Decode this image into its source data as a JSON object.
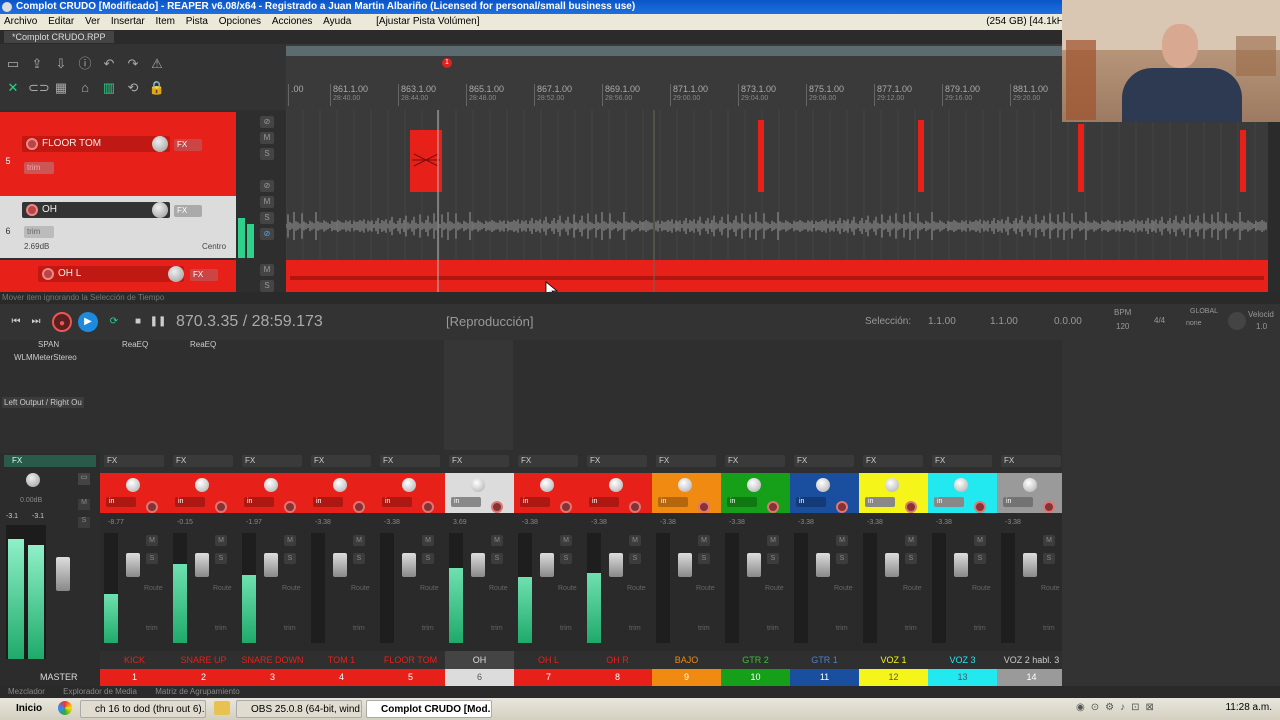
{
  "window": {
    "title": "Complot CRUDO [Modificado] - REAPER v6.08/x64 - Registrado a Juan Martin Albariño (Licensed for personal/small business use)"
  },
  "menu": {
    "items": [
      "Archivo",
      "Editar",
      "Ver",
      "Insertar",
      "Item",
      "Pista",
      "Opciones",
      "Acciones",
      "Ayuda",
      "[Ajustar Pista Volúmen]"
    ],
    "disk_info": "(254 GB) [44.1kH"
  },
  "project_tab": "*Complot CRUDO.RPP",
  "ruler": {
    "marker": "1",
    "ticks": [
      {
        "bar": ".00",
        "time": ""
      },
      {
        "bar": "861.1.00",
        "time": "28:40.00"
      },
      {
        "bar": "863.1.00",
        "time": "28:44.00"
      },
      {
        "bar": "865.1.00",
        "time": "28:48.00"
      },
      {
        "bar": "867.1.00",
        "time": "28:52.00"
      },
      {
        "bar": "869.1.00",
        "time": "28:56.00"
      },
      {
        "bar": "871.1.00",
        "time": "29:00.00"
      },
      {
        "bar": "873.1.00",
        "time": "29:04.00"
      },
      {
        "bar": "875.1.00",
        "time": "29:08.00"
      },
      {
        "bar": "877.1.00",
        "time": "29:12.00"
      },
      {
        "bar": "879.1.00",
        "time": "29:16.00"
      },
      {
        "bar": "881.1.00",
        "time": "29:20.00"
      }
    ]
  },
  "tracks": [
    {
      "num": "5",
      "name": "FLOOR TOM",
      "fx": "FX",
      "trim": "trim",
      "color": "#e8201a"
    },
    {
      "num": "6",
      "name": "OH",
      "fx": "FX",
      "trim": "trim",
      "vol": "2.69dB",
      "pan": "Centro",
      "color": "#dcdcdc"
    },
    {
      "num": "",
      "name": "OH L",
      "fx": "FX",
      "color": "#e8201a"
    }
  ],
  "status": {
    "hint": "Mover item ignorando la Selección de Tiempo"
  },
  "transport": {
    "time": "870.3.35 / 28:59.173",
    "state": "[Reproducción]",
    "selection_label": "Selección:",
    "sel_start": "1.1.00",
    "sel_end": "1.1.00",
    "sel_len": "0.0.00",
    "bpm_label": "BPM",
    "bpm": "120",
    "timesig": "4/4",
    "global_label": "GLOBAL",
    "global_value": "none",
    "rate_label": "Velocid",
    "rate_value": "1.0"
  },
  "mixer": {
    "master_fx": [
      "SPAN",
      "WLMMeterStereo"
    ],
    "reaeq1": "ReaEQ",
    "reaeq2": "ReaEQ",
    "master_io": "Left Output / Right Ou",
    "master_label": "MASTER",
    "master_vol": "0.00dB",
    "master_peak_l": "-3.1",
    "master_peak_r": "-3.1",
    "strips": [
      {
        "name": "KICK",
        "num": "1",
        "color": "#e8201a",
        "namecolor": "#e8201a",
        "vol": "-8.77",
        "level": 0.45
      },
      {
        "name": "SNARE UP",
        "num": "2",
        "color": "#e8201a",
        "namecolor": "#e8201a",
        "vol": "-0.15",
        "level": 0.72
      },
      {
        "name": "SNARE DOWN",
        "num": "3",
        "color": "#e8201a",
        "namecolor": "#e8201a",
        "vol": "-1.97",
        "level": 0.62
      },
      {
        "name": "TOM 1",
        "num": "4",
        "color": "#e8201a",
        "namecolor": "#e8201a",
        "vol": "-3.38",
        "level": 0.0
      },
      {
        "name": "FLOOR TOM",
        "num": "5",
        "color": "#e8201a",
        "namecolor": "#e8201a",
        "vol": "-3.38",
        "level": 0.0
      },
      {
        "name": "OH",
        "num": "6",
        "color": "#dcdcdc",
        "namecolor": "#dddddd",
        "vol": "3.69",
        "level": 0.68
      },
      {
        "name": "OH L",
        "num": "7",
        "color": "#e8201a",
        "namecolor": "#e8201a",
        "vol": "-3.38",
        "level": 0.6
      },
      {
        "name": "OH R",
        "num": "8",
        "color": "#e8201a",
        "namecolor": "#e8201a",
        "vol": "-3.38",
        "level": 0.64
      },
      {
        "name": "BAJO",
        "num": "9",
        "color": "#f08a10",
        "namecolor": "#f08a10",
        "vol": "-3.38",
        "level": 0.0
      },
      {
        "name": "GTR 2",
        "num": "10",
        "color": "#16a01a",
        "namecolor": "#35c035",
        "vol": "-3.38",
        "level": 0.0
      },
      {
        "name": "GTR 1",
        "num": "11",
        "color": "#1a4fa0",
        "namecolor": "#4a7fd0",
        "vol": "-3.38",
        "level": 0.0
      },
      {
        "name": "VOZ 1",
        "num": "12",
        "color": "#f5f51a",
        "namecolor": "#f5f51a",
        "vol": "-3.38",
        "level": 0.0
      },
      {
        "name": "VOZ 3",
        "num": "13",
        "color": "#22e8f0",
        "namecolor": "#22e8f0",
        "vol": "-3.38",
        "level": 0.0
      },
      {
        "name": "VOZ 2 habl. 3",
        "num": "14",
        "color": "#9a9a9a",
        "namecolor": "#cccccc",
        "vol": "-3.38",
        "level": 0.0
      }
    ]
  },
  "docker_tabs": [
    "Mezclador",
    "Explorador de Media",
    "Matriz de Agrupamiento"
  ],
  "taskbar": {
    "start": "Inicio",
    "items": [
      "ch 16 to dod (thru out 6)...",
      "OBS 25.0.8 (64-bit, wind...",
      "Complot CRUDO [Mod..."
    ],
    "clock": "11:28 a.m."
  },
  "colors": {
    "track_red": "#e8201a",
    "meter_green": "#2ed08a"
  }
}
